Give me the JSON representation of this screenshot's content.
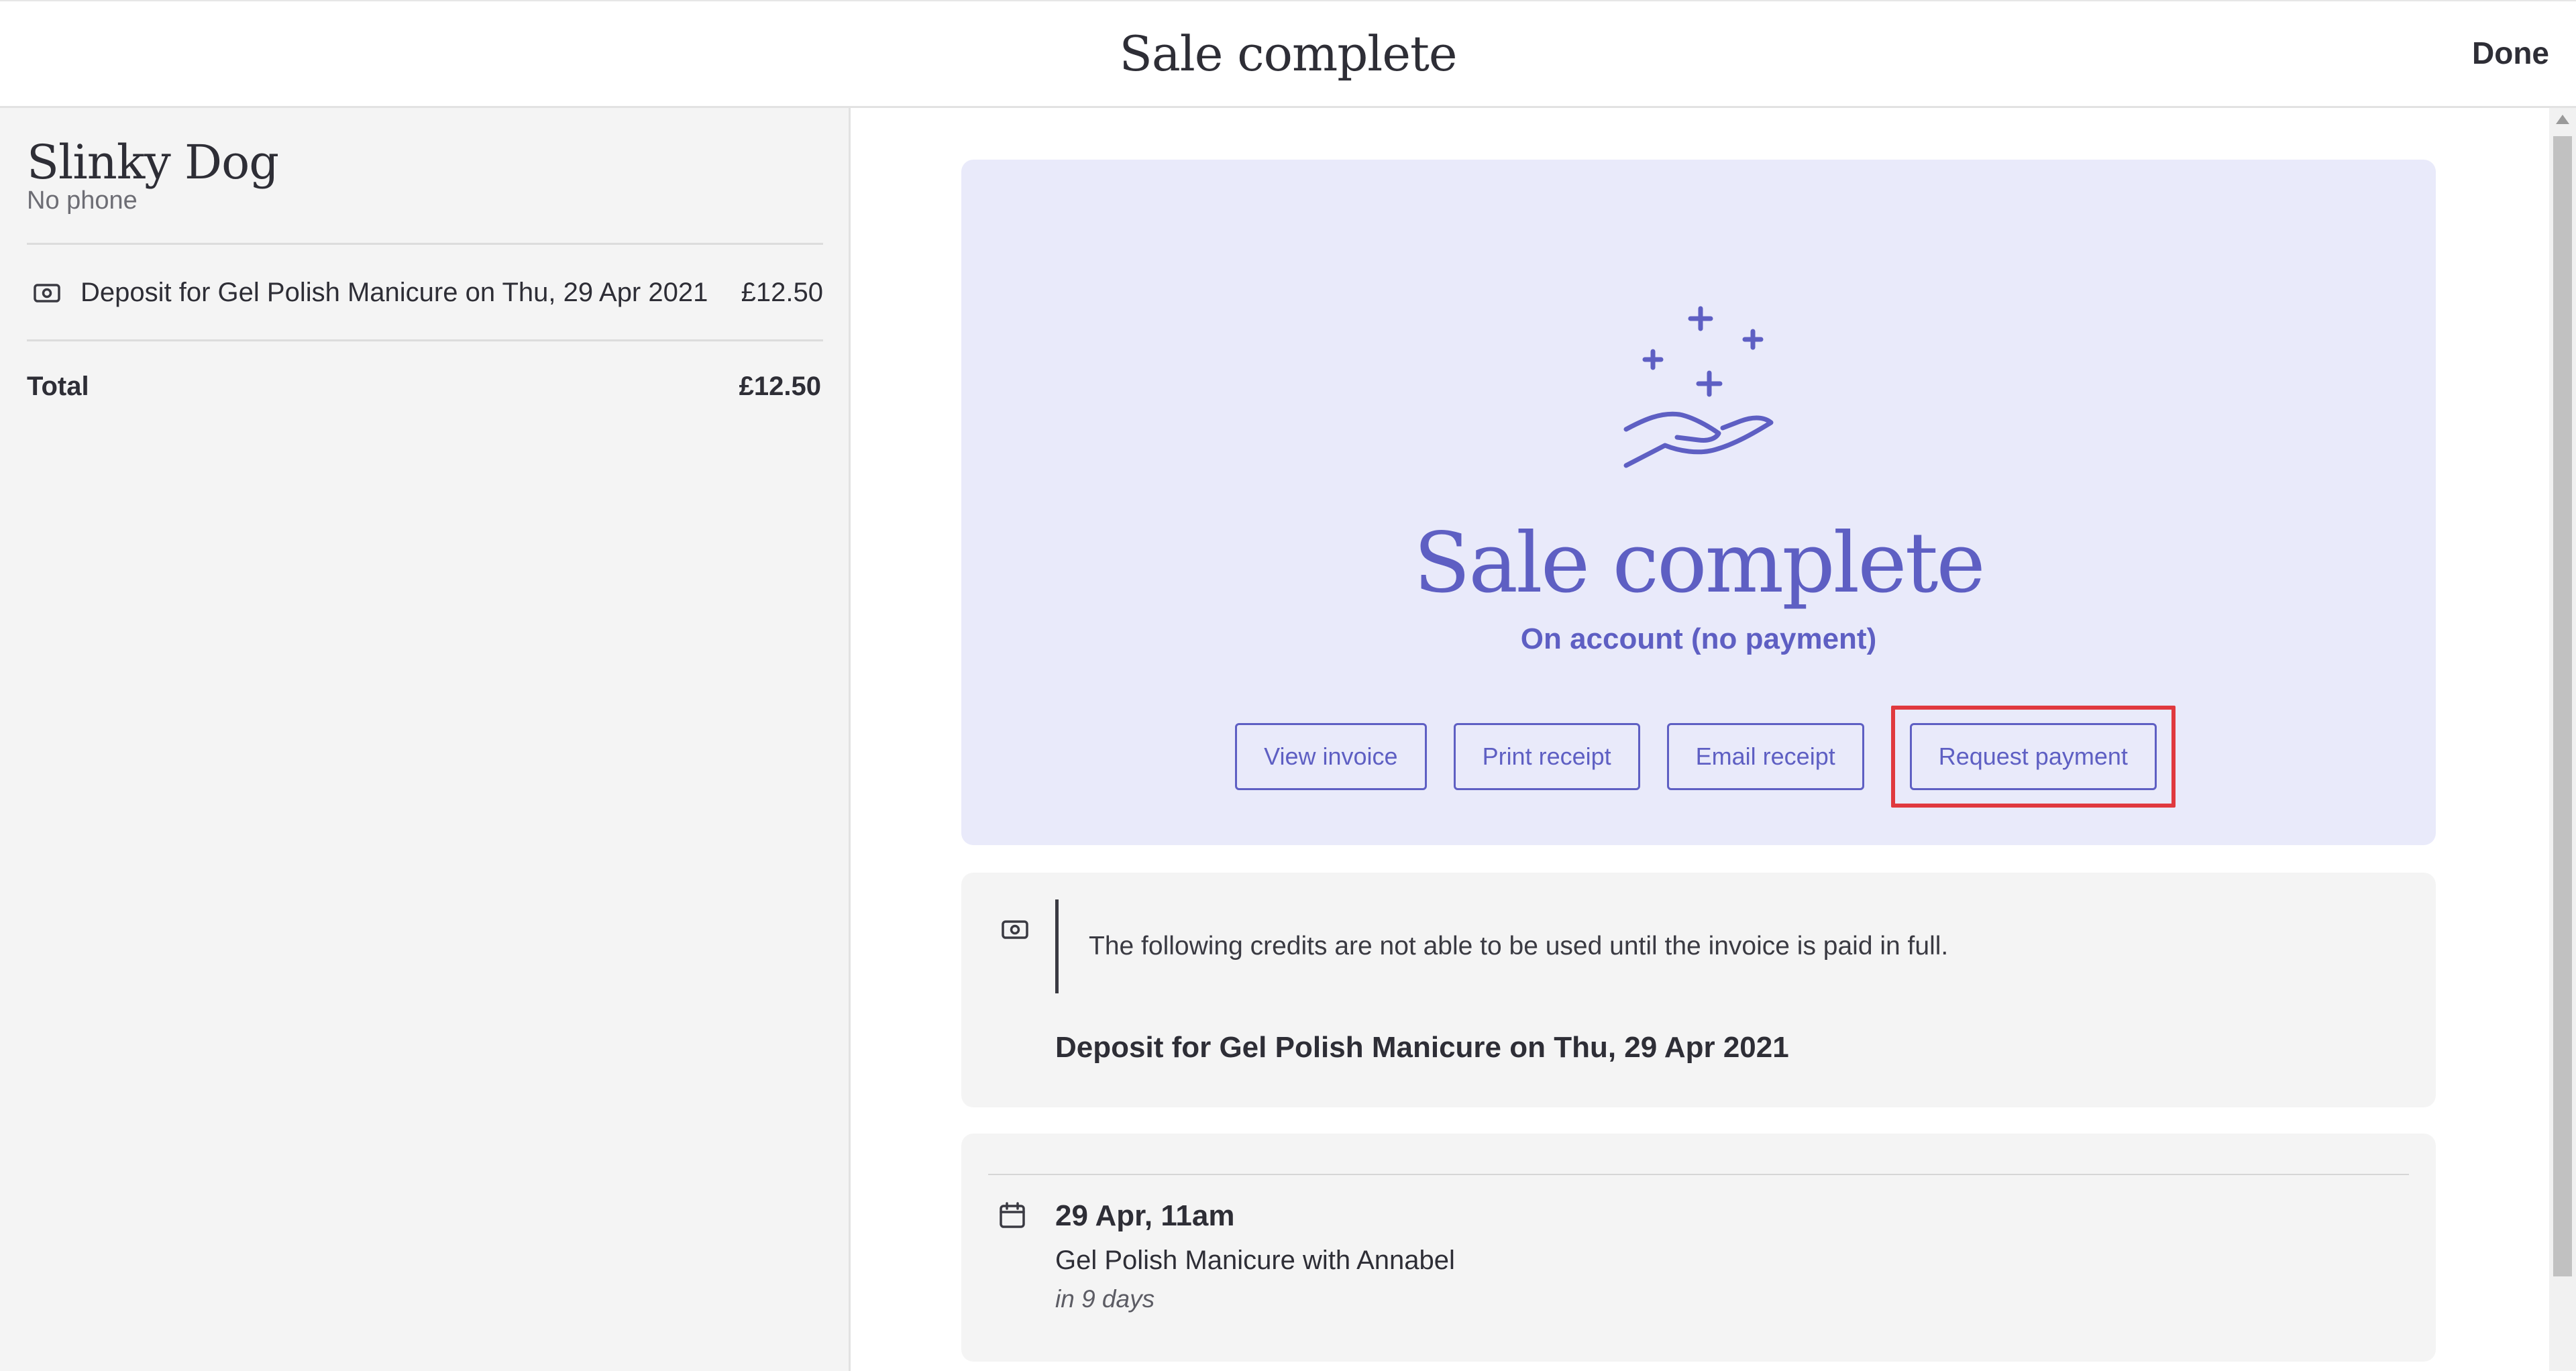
{
  "header": {
    "title": "Sale complete",
    "done_label": "Done"
  },
  "client": {
    "name": "Slinky Dog",
    "phone": "No phone"
  },
  "cart": {
    "items": [
      {
        "label": "Deposit for Gel Polish Manicure on Thu, 29 Apr 2021",
        "price": "£12.50"
      }
    ],
    "total_label": "Total",
    "total_value": "£12.50"
  },
  "hero": {
    "title": "Sale complete",
    "subtitle": "On account (no payment)",
    "actions": {
      "view_invoice": "View invoice",
      "print_receipt": "Print receipt",
      "email_receipt": "Email receipt",
      "request_payment": "Request payment"
    }
  },
  "credits": {
    "note": "The following credits are not able to be used until the invoice is paid in full.",
    "item": "Deposit for Gel Polish Manicure on Thu, 29 Apr 2021"
  },
  "appointment": {
    "time": "29 Apr, 11am",
    "service": "Gel Polish Manicure with Annabel",
    "relative": "in 9 days"
  },
  "icons": {
    "money": "money-icon",
    "calendar": "calendar-icon",
    "hand_sparkles": "hand-sparkles-icon"
  },
  "colors": {
    "accent": "#5e5fc3",
    "hero_bg": "#e9eafa",
    "highlight": "#e0393e"
  }
}
